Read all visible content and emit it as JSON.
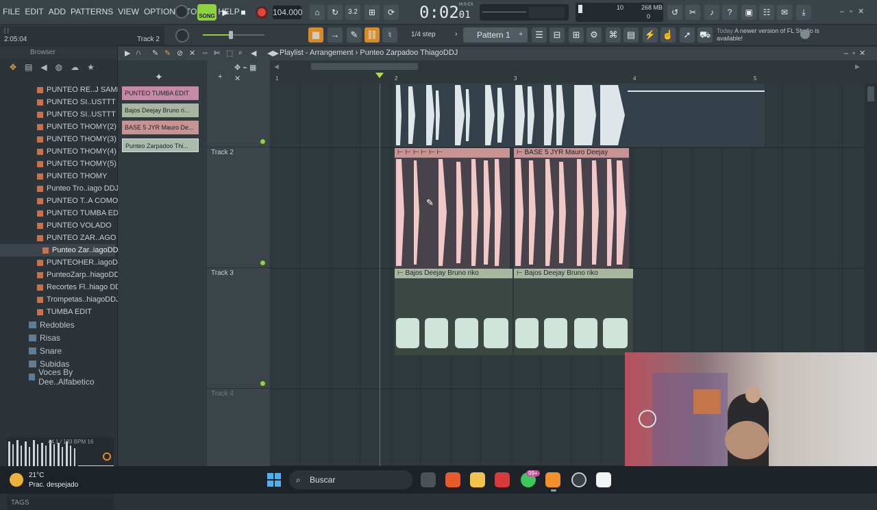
{
  "menu": [
    "FILE",
    "EDIT",
    "ADD",
    "PATTERNS",
    "VIEW",
    "OPTIONS",
    "TOOLS",
    "HELP"
  ],
  "transport": {
    "mode": "SONG",
    "tempo": "104.000",
    "time_main": "0:02",
    "time_sub": "01",
    "time_label": "M:S:CS"
  },
  "cpu": {
    "polyphony": "10",
    "memory": "268 MB",
    "voices": "0"
  },
  "hint": {
    "position": "2:05:04",
    "target": "Track 2",
    "bracket": "[ ]"
  },
  "toolbar2": {
    "step": "1/4 step",
    "pattern": "Pattern 1"
  },
  "news": {
    "today": "Today",
    "message": "A newer version of FL Studio is available!"
  },
  "browser": {
    "title": "Browser",
    "items": [
      "PUNTEO RE..J SAMPLE",
      "PUNTEO SI..USTTT RMX",
      "PUNTEO SI..USTTT RMX",
      "PUNTEO THOMY(2)",
      "PUNTEO THOMY(3)",
      "PUNTEO THOMY(4)",
      "PUNTEO THOMY(5)",
      "PUNTEO THOMY",
      "Punteo Tro..iago DDJ)",
      "PUNTEO T..A COMO YO",
      "PUNTEO TUMBA EDIT",
      "PUNTEO VOLADO",
      "PUNTEO ZAR..AGO DDJ",
      "Punteo Zar..iagoDDJ",
      "PUNTEOHER..iagoDDJ",
      "PunteoZarp..hiagoDDJ",
      "Recortes Fl..hiago DDJ",
      "Trompetas..hiagoDDJ)",
      "TUMBA EDIT"
    ],
    "selected_index": 13,
    "folders": [
      "Redobles",
      "Risas",
      "Snare",
      "Subidas",
      "Voces By Dee..Alfabetico"
    ],
    "preview_info": "44.1 / 183 BPM  16",
    "tags_label": "TAGS"
  },
  "playlist": {
    "title": "Playlist - Arrangement",
    "arrow": "›",
    "project": "Punteo Zarpadoo ThiagoDDJ",
    "picker": [
      {
        "label": "PUNTEO TUMBA EDIT",
        "color": "#c889a5"
      },
      {
        "label": "Bajos Deejay Bruno ri...",
        "color": "#a9b7a0"
      },
      {
        "label": "BASE 5 JYR Mauro De...",
        "color": "#c89393"
      },
      {
        "label": "Punteo Zarpadoo Thi...",
        "color": "#a9bcae"
      }
    ],
    "ruler": [
      "1",
      "2",
      "3",
      "4",
      "5"
    ],
    "tracks": [
      "Track 2",
      "Track 3",
      "Track 4"
    ],
    "clips": {
      "base5_label": "BASE 5 JYR Mauro Deejay",
      "bajos_label_a": "Bajos Deejay Bruno riko",
      "bajos_label_b": "Bajos Deejay Bruno riko"
    }
  },
  "taskbar": {
    "temp": "21°C",
    "weather": "Prac. despejado",
    "search": "Buscar",
    "badge": "99+"
  },
  "colors": {
    "accent_green": "#8fd23f",
    "clip_pink": "#f0c8c8",
    "clip_white": "#dfe6ea",
    "clip_mint": "#cfe5da",
    "record_red": "#e0463c"
  }
}
